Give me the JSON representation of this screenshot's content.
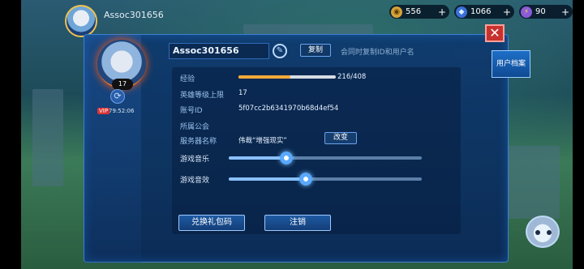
{
  "hud": {
    "player_name": "Assoc301656",
    "level": "17",
    "resources": [
      {
        "icon": "coin-icon",
        "value": "556",
        "color": "#d6a23a"
      },
      {
        "icon": "crystal-icon",
        "value": "1066",
        "color": "#7fb2ff"
      },
      {
        "icon": "energy-icon",
        "value": "90",
        "color": "#f5c43a"
      }
    ]
  },
  "dialog": {
    "name": "Assoc301656",
    "copy_label": "复制",
    "copy_hint": "会同时复制ID和用户名",
    "level_badge": "17",
    "vip_label": "VIP",
    "vip_time": "79:52:06",
    "rows": {
      "exp_label": "经验",
      "exp_value": "216/408",
      "exp_progress": 0.53,
      "hero_cap_label": "英雄等级上限",
      "hero_cap_value": "17",
      "account_id_label": "账号ID",
      "account_id_value": "5f07cc2b6341970b68d4ef54",
      "guild_label": "所属公会",
      "guild_value": "",
      "server_label": "服务器名称",
      "server_value": "伟裁“增强现实”",
      "change_label": "改变"
    },
    "music": {
      "label": "游戏音乐",
      "level": 0.3
    },
    "sfx": {
      "label": "游戏音效",
      "level": 0.4
    },
    "redeem_label": "兑换礼包码",
    "logout_label": "注销",
    "profile_tab_label": "用户档案",
    "close_symbol": "✕"
  }
}
